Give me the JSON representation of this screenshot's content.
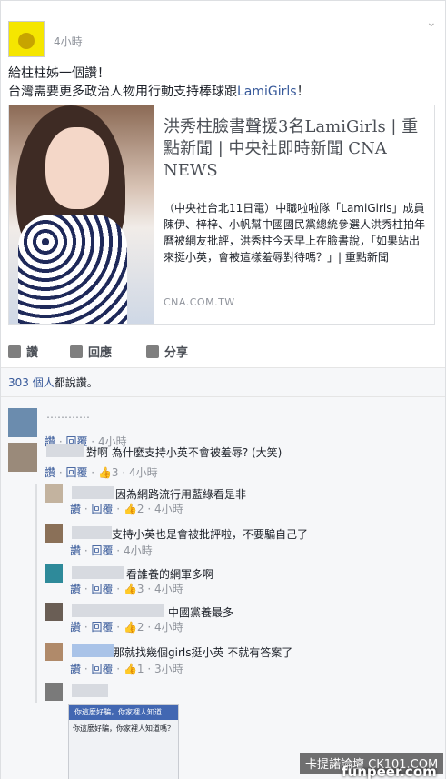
{
  "post": {
    "time": "4小時",
    "chevron": "⌄",
    "text_line1": "給柱柱姊一個讚！",
    "text_line2_prefix": "台灣需要更多政治人物用行動支持棒球跟",
    "text_line2_link": "LamiGirls",
    "text_line2_suffix": "！"
  },
  "link_card": {
    "title": "洪秀柱臉書聲援3名LamiGirls | 重點新聞 | 中央社即時新聞 CNA NEWS",
    "description": "（中央社台北11日電）中職啦啦隊「LamiGirls」成員陳伊、梓梓、小帆幫中國國民黨總統參選人洪秀柱拍年曆被網友批評，洪秀柱今天早上在臉書說，「如果站出來挺小英，會被這樣羞辱對待嗎？」| 重點新聞",
    "domain": "CNA.COM.TW"
  },
  "actions": {
    "like": "讚",
    "comment": "回應",
    "share": "分享"
  },
  "likes_summary": {
    "count": "303 個人",
    "suffix": "都說讚。"
  },
  "comments": [
    {
      "name": "…………",
      "text": "",
      "meta_like": "讚",
      "meta_reply": "回覆",
      "likes": "",
      "time": "4小時"
    },
    {
      "name": "",
      "text": "對啊 為什麼支持小英不會被羞辱? (大笑)",
      "meta_like": "讚",
      "meta_reply": "回覆",
      "likes": "3",
      "time": "4小時"
    },
    {
      "name": "",
      "text": "因為網路流行用藍綠看是非",
      "meta_like": "讚",
      "meta_reply": "回覆",
      "likes": "2",
      "time": "4小時"
    },
    {
      "name": "",
      "text": "支持小英也是會被批評啦，不要騙自己了",
      "meta_like": "讚",
      "meta_reply": "回覆",
      "likes": "",
      "time": "4小時"
    },
    {
      "name": "",
      "text": "看誰養的網軍多啊",
      "meta_like": "讚",
      "meta_reply": "回覆",
      "likes": "3",
      "time": "4小時"
    },
    {
      "name": "",
      "text": "中國黨養最多",
      "meta_like": "讚",
      "meta_reply": "回覆",
      "likes": "2",
      "time": "4小時"
    },
    {
      "name": "",
      "text": "那就找幾個girls挺小英 不就有答案了",
      "meta_like": "讚",
      "meta_reply": "回覆",
      "likes": "1",
      "time": "3小時"
    }
  ],
  "screenshot_preview": {
    "bar_text": "你這麼好騙，你家裡人知道…",
    "question": "你這麼好騙，你家裡人知道嗎？"
  },
  "watermarks": {
    "top": "卡提諾論壇 CK101.COM",
    "bottom": "funpeer.com"
  }
}
